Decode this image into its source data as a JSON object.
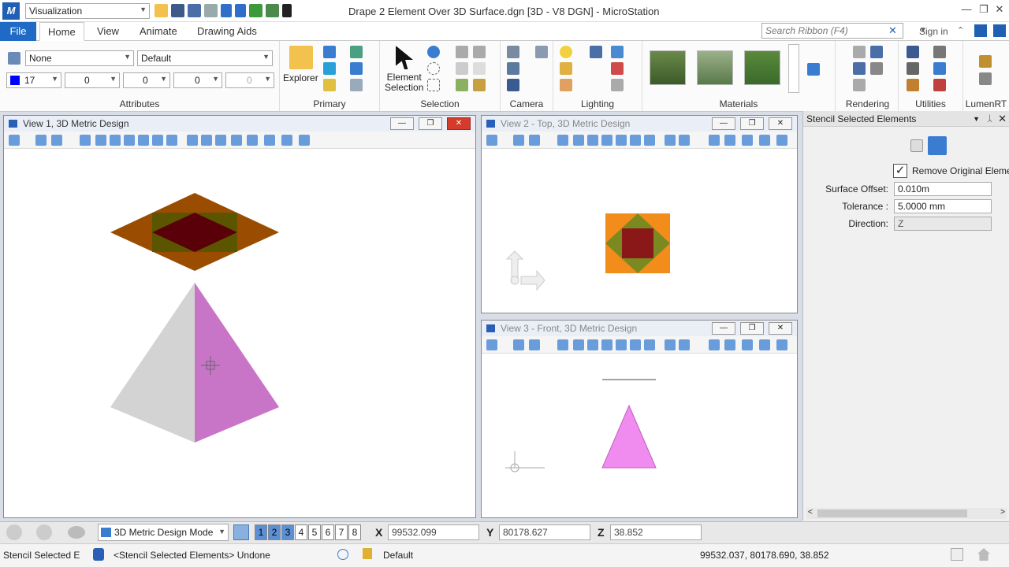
{
  "titlebar": {
    "workspace": "Visualization",
    "title": "Drape 2 Element Over 3D Surface.dgn [3D - V8 DGN] - MicroStation",
    "app_icon": "M"
  },
  "tabs": {
    "file": "File",
    "items": [
      "Home",
      "View",
      "Animate",
      "Drawing Aids"
    ],
    "search_placeholder": "Search Ribbon (F4)",
    "signin": "Sign in"
  },
  "ribbon": {
    "attributes": {
      "level": "None",
      "style": "Default",
      "color": "17",
      "linestyle": "0",
      "weight": "0",
      "transparency": "0",
      "priority": "0",
      "label": "Attributes"
    },
    "primary": {
      "explorer": "Explorer",
      "label": "Primary"
    },
    "selection": {
      "element": "Element",
      "selection": "Selection",
      "label": "Selection"
    },
    "camera": "Camera",
    "lighting": "Lighting",
    "materials": "Materials",
    "rendering": "Rendering",
    "utilities": "Utilities",
    "lumenrt": "LumenRT"
  },
  "views": {
    "v1": "View 1, 3D Metric Design",
    "v2": "View 2 - Top, 3D Metric Design",
    "v3": "View 3 - Front, 3D Metric Design"
  },
  "panel": {
    "title": "Stencil Selected Elements",
    "remove_original": "Remove Original Eleme",
    "remove_checked": true,
    "surface_offset_label": "Surface Offset:",
    "surface_offset": "0.010m",
    "tolerance_label": "Tolerance :",
    "tolerance": "5.0000 mm",
    "direction_label": "Direction:",
    "direction": "Z"
  },
  "statusbar": {
    "mode": "3D Metric Design Mode",
    "view_numbers": [
      "1",
      "2",
      "3",
      "4",
      "5",
      "6",
      "7",
      "8"
    ],
    "x_label": "X",
    "x": "99532.099",
    "y_label": "Y",
    "y": "80178.627",
    "z_label": "Z",
    "z": "38.852",
    "tool": "Stencil Selected E",
    "prompt": "<Stencil Selected Elements> Undone",
    "level": "Default",
    "coords": "99532.037, 80178.690, 38.852"
  },
  "colors": {
    "accent": "#1f6ac4",
    "pyramid_left": "#d3d3d3",
    "pyramid_right": "#c875c8",
    "triangle_front": "#f08cf0"
  }
}
